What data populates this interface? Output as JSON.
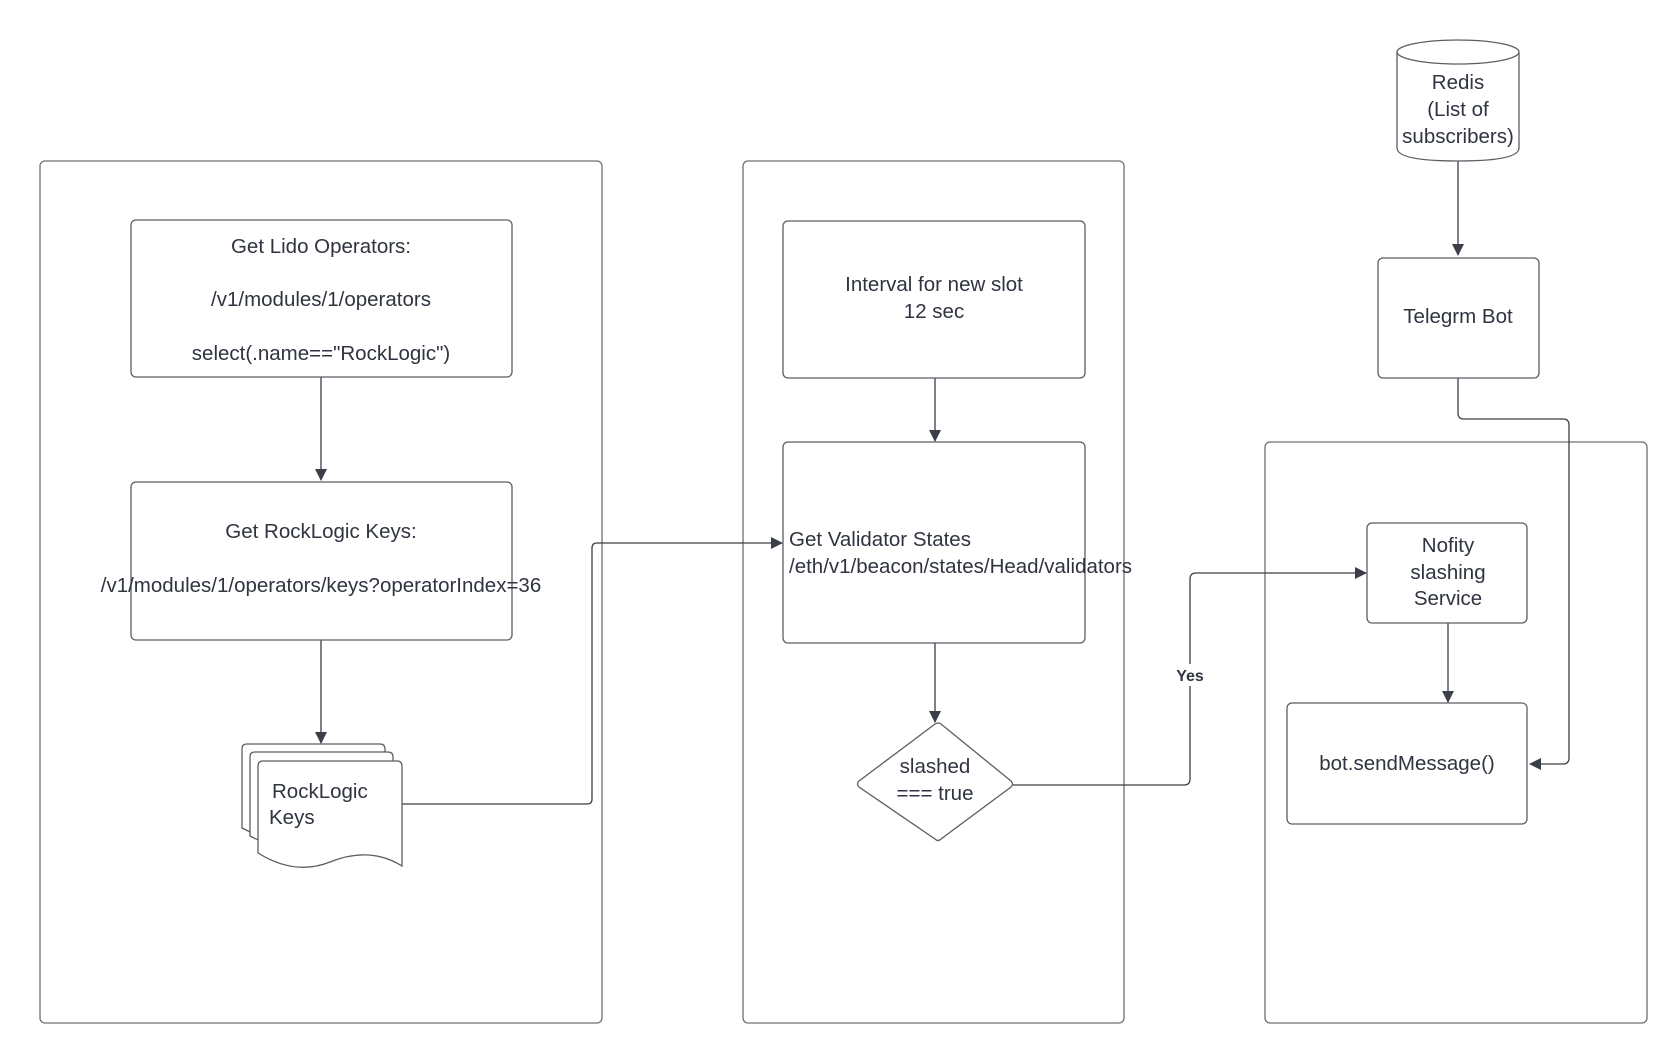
{
  "diagram": {
    "type": "flowchart",
    "swimlanes": [
      {
        "id": "lane-lido",
        "label": ""
      },
      {
        "id": "lane-validator",
        "label": ""
      },
      {
        "id": "lane-notify",
        "label": ""
      }
    ],
    "nodes": {
      "lido_operators": {
        "shape": "process",
        "lines": [
          "Get Lido Operators:",
          "/v1/modules/1/operators",
          "select(.name==\"RockLogic\")"
        ]
      },
      "rocklogic_keys_request": {
        "shape": "process",
        "lines": [
          "Get RockLogic Keys:",
          "/v1/modules/1/operators/keys?operatorIndex=36"
        ]
      },
      "rocklogic_keys_docs": {
        "shape": "multi-document",
        "lines": [
          "RockLogic",
          "Keys"
        ]
      },
      "interval": {
        "shape": "process",
        "lines": [
          "Interval for new slot",
          "12 sec"
        ]
      },
      "validator_states": {
        "shape": "process",
        "lines": [
          "Get Validator States",
          "/eth/v1/beacon/states/Head/validators"
        ]
      },
      "slashed_decision": {
        "shape": "decision",
        "lines": [
          "slashed",
          "=== true"
        ]
      },
      "redis": {
        "shape": "database",
        "lines": [
          "Redis",
          "(List of",
          "subscribers)"
        ]
      },
      "telegram_bot": {
        "shape": "process",
        "lines": [
          "Telegrm Bot"
        ]
      },
      "notify_service": {
        "shape": "process",
        "lines": [
          "Nofity",
          "slashing",
          "Service"
        ]
      },
      "send_message": {
        "shape": "process",
        "lines": [
          "bot.sendMessage()"
        ]
      }
    },
    "edges": [
      {
        "from": "lido_operators",
        "to": "rocklogic_keys_request",
        "label": ""
      },
      {
        "from": "rocklogic_keys_request",
        "to": "rocklogic_keys_docs",
        "label": ""
      },
      {
        "from": "rocklogic_keys_docs",
        "to": "validator_states",
        "label": ""
      },
      {
        "from": "interval",
        "to": "validator_states",
        "label": ""
      },
      {
        "from": "validator_states",
        "to": "slashed_decision",
        "label": ""
      },
      {
        "from": "slashed_decision",
        "to": "notify_service",
        "label": "Yes"
      },
      {
        "from": "redis",
        "to": "telegram_bot",
        "label": ""
      },
      {
        "from": "telegram_bot",
        "to": "send_message",
        "label": ""
      },
      {
        "from": "notify_service",
        "to": "send_message",
        "label": ""
      }
    ]
  }
}
